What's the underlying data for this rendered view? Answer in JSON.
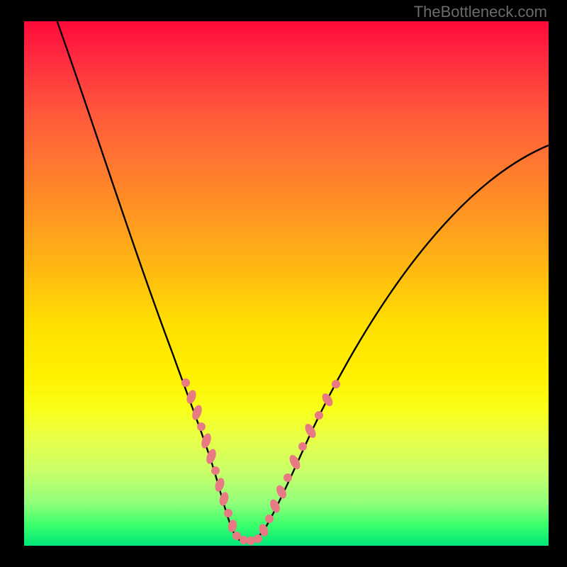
{
  "watermark": "TheBottleneck.com",
  "colors": {
    "frame": "#000000",
    "curve": "#000000",
    "beads": "#e77a82"
  },
  "chart_data": {
    "type": "line",
    "title": "",
    "xlabel": "",
    "ylabel": "",
    "xlim": [
      0,
      100
    ],
    "ylim": [
      0,
      100
    ],
    "series": [
      {
        "name": "curve",
        "x": [
          5,
          10,
          15,
          20,
          25,
          28,
          30,
          32,
          34,
          36,
          38,
          40,
          44,
          48,
          52,
          56,
          60,
          66,
          72,
          80,
          90,
          100
        ],
        "y": [
          100,
          88,
          74,
          59,
          42,
          30,
          22,
          14,
          8,
          4,
          2,
          1,
          1,
          3,
          7,
          13,
          20,
          30,
          40,
          52,
          64,
          72
        ]
      }
    ],
    "annotations": {
      "beads_left": {
        "x_range": [
          26,
          34
        ],
        "y_range": [
          8,
          32
        ]
      },
      "beads_right": {
        "x_range": [
          40,
          50
        ],
        "y_range": [
          2,
          24
        ]
      },
      "beads_bottom": {
        "x_range": [
          34,
          40
        ],
        "y_range": [
          1,
          4
        ]
      }
    }
  }
}
